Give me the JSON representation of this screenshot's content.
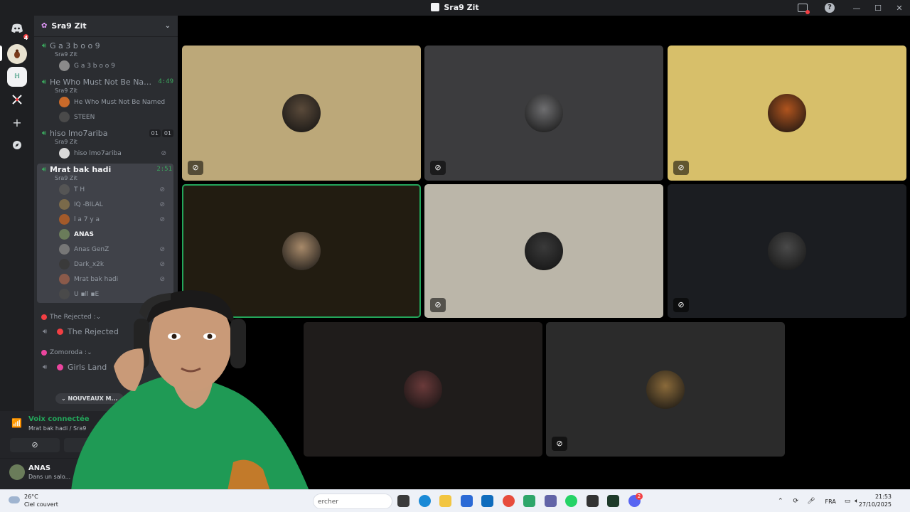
{
  "window": {
    "title": "Sra9 Zit",
    "controls": {
      "minimize": "—",
      "maximize": "☐",
      "close": "✕"
    },
    "help": "?"
  },
  "rail": {
    "discord_badge": "4",
    "servers": [
      "direct-messages",
      "Sra9 Zit",
      "server-2",
      "server-3"
    ],
    "add_server": "+",
    "discover": "⊘"
  },
  "sidebar": {
    "guild_name": "Sra9 Zit",
    "voice_channels": [
      {
        "name": "G a 3 b o o 9",
        "server": "Sra9 Zit",
        "timer": "",
        "members": [
          {
            "name": "G a 3 b o o 9",
            "color": "#8a8a8a",
            "muted": false,
            "bright": false
          }
        ]
      },
      {
        "name": "He Who Must Not Be Nam...",
        "server": "Sra9 Zit",
        "timer": "4:49",
        "members": [
          {
            "name": "He Who Must Not Be Named",
            "color": "#c96a2a",
            "muted": false,
            "bright": false
          },
          {
            "name": "STEEN",
            "color": "#4a4a4a",
            "muted": false,
            "bright": false
          }
        ]
      },
      {
        "name": "hiso lmo7ariba",
        "server": "Sra9 Zit",
        "counts": [
          "01",
          "01"
        ],
        "members": [
          {
            "name": "hiso lmo7ariba",
            "color": "#d8d8d8",
            "muted": true,
            "bright": false
          }
        ]
      },
      {
        "name": "Mrat bak hadi",
        "server": "Sra9 Zit",
        "timer": "2:51",
        "active": true,
        "members": [
          {
            "name": "T H",
            "color": "#555555",
            "muted": true,
            "bright": false
          },
          {
            "name": "IQ -BILAL",
            "color": "#7a6a4a",
            "muted": true,
            "bright": false
          },
          {
            "name": "l a 7 y a",
            "color": "#a35a2a",
            "muted": true,
            "bright": false
          },
          {
            "name": "ANAS",
            "color": "#6a7c5a",
            "muted": false,
            "bright": true
          },
          {
            "name": "Anas GenZ",
            "color": "#777777",
            "muted": true,
            "bright": false
          },
          {
            "name": "Dark_x2k",
            "color": "#3a3a3a",
            "muted": true,
            "bright": false
          },
          {
            "name": "Mrat bak hadi",
            "color": "#8a5a4a",
            "muted": true,
            "bright": false
          },
          {
            "name": "U ▪ll ▪E",
            "color": "#4a4a4a",
            "muted": false,
            "bright": false
          }
        ]
      }
    ],
    "categories": [
      {
        "name": "The Rejected :",
        "color": "#f23f43",
        "channel": "The Rejected"
      },
      {
        "name": "Zomoroda :",
        "color": "#eb459e",
        "channel": "Girls Land"
      }
    ],
    "new_unreads": "NOUVEAUX M..."
  },
  "voice_status": {
    "title": "Voix connectée",
    "location": "Mrat bak hadi / Sra9",
    "camera_button": "⊘"
  },
  "user": {
    "name": "ANAS",
    "status": "Dans un salo..."
  },
  "stage": {
    "tiles": [
      {
        "bg": "#bca879",
        "avatar": "#5a4a3a",
        "muted": true,
        "speaking": false
      },
      {
        "bg": "#3c3c3e",
        "avatar": "#6e6e70",
        "muted": true,
        "speaking": false
      },
      {
        "bg": "#d7bf6a",
        "avatar": "#b0541e",
        "muted": true,
        "speaking": false
      },
      {
        "bg": "#221c11",
        "avatar": "#a88a6a",
        "muted": false,
        "speaking": true
      },
      {
        "bg": "#bbb6a9",
        "avatar": "#3a3a3a",
        "muted": true,
        "speaking": false
      },
      {
        "bg": "#1b1d21",
        "avatar": "#4a4a4a",
        "muted": true,
        "speaking": false
      },
      {
        "bg": "#1f1c1b",
        "avatar": "#6a3a3a",
        "muted": false,
        "speaking": false
      },
      {
        "bg": "#2b2b2b",
        "avatar": "#8a6a3a",
        "muted": true,
        "speaking": false
      }
    ]
  },
  "taskbar": {
    "temperature": "26°C",
    "weather": "Ciel couvert",
    "search_placeholder": "ercher",
    "lang": "FRA",
    "time": "21:53",
    "date": "27/10/2025",
    "app_badge_discord": "2",
    "apps": [
      {
        "name": "task-view",
        "color": "#3b3b3b"
      },
      {
        "name": "edge",
        "color": "#1b8ad6"
      },
      {
        "name": "file-explorer",
        "color": "#f2c541"
      },
      {
        "name": "store",
        "color": "#2b6ad6"
      },
      {
        "name": "outlook",
        "color": "#0f6cbd"
      },
      {
        "name": "chrome",
        "color": "#e74c3c"
      },
      {
        "name": "app-green",
        "color": "#2ea66a"
      },
      {
        "name": "teams",
        "color": "#6264a7"
      },
      {
        "name": "whatsapp",
        "color": "#25d366"
      },
      {
        "name": "app-dark",
        "color": "#333333"
      },
      {
        "name": "terminal",
        "color": "#1f3b2a"
      },
      {
        "name": "discord",
        "color": "#5865f2"
      }
    ]
  }
}
